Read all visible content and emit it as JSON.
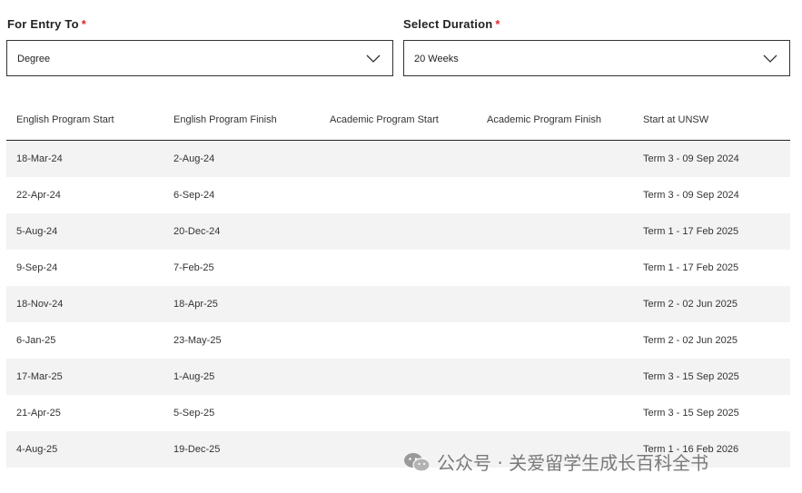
{
  "entry": {
    "label": "For Entry To",
    "required_mark": "*",
    "value": "Degree"
  },
  "duration": {
    "label": "Select Duration",
    "required_mark": "*",
    "value": "20 Weeks"
  },
  "table": {
    "columns": [
      "English Program Start",
      "English Program Finish",
      "Academic Program Start",
      "Academic Program Finish",
      "Start at UNSW"
    ],
    "rows": [
      [
        "18-Mar-24",
        "2-Aug-24",
        "",
        "",
        "Term 3 - 09 Sep 2024"
      ],
      [
        "22-Apr-24",
        "6-Sep-24",
        "",
        "",
        "Term 3 - 09 Sep 2024"
      ],
      [
        "5-Aug-24",
        "20-Dec-24",
        "",
        "",
        "Term 1 - 17 Feb 2025"
      ],
      [
        "9-Sep-24",
        "7-Feb-25",
        "",
        "",
        "Term 1 - 17 Feb 2025"
      ],
      [
        "18-Nov-24",
        "18-Apr-25",
        "",
        "",
        "Term 2 - 02 Jun 2025"
      ],
      [
        "6-Jan-25",
        "23-May-25",
        "",
        "",
        "Term 2 - 02 Jun 2025"
      ],
      [
        "17-Mar-25",
        "1-Aug-25",
        "",
        "",
        "Term 3 - 15 Sep 2025"
      ],
      [
        "21-Apr-25",
        "5-Sep-25",
        "",
        "",
        "Term 3 - 15 Sep 2025"
      ],
      [
        "4-Aug-25",
        "19-Dec-25",
        "",
        "",
        "Term 1 - 16 Feb 2026"
      ]
    ]
  },
  "watermark": {
    "text": "公众号 · 关爱留学生成长百科全书",
    "icon": "wechat-icon"
  },
  "colors": {
    "required": "#e0262b",
    "row_alt": "#f3f3f3",
    "border": "#333333"
  }
}
